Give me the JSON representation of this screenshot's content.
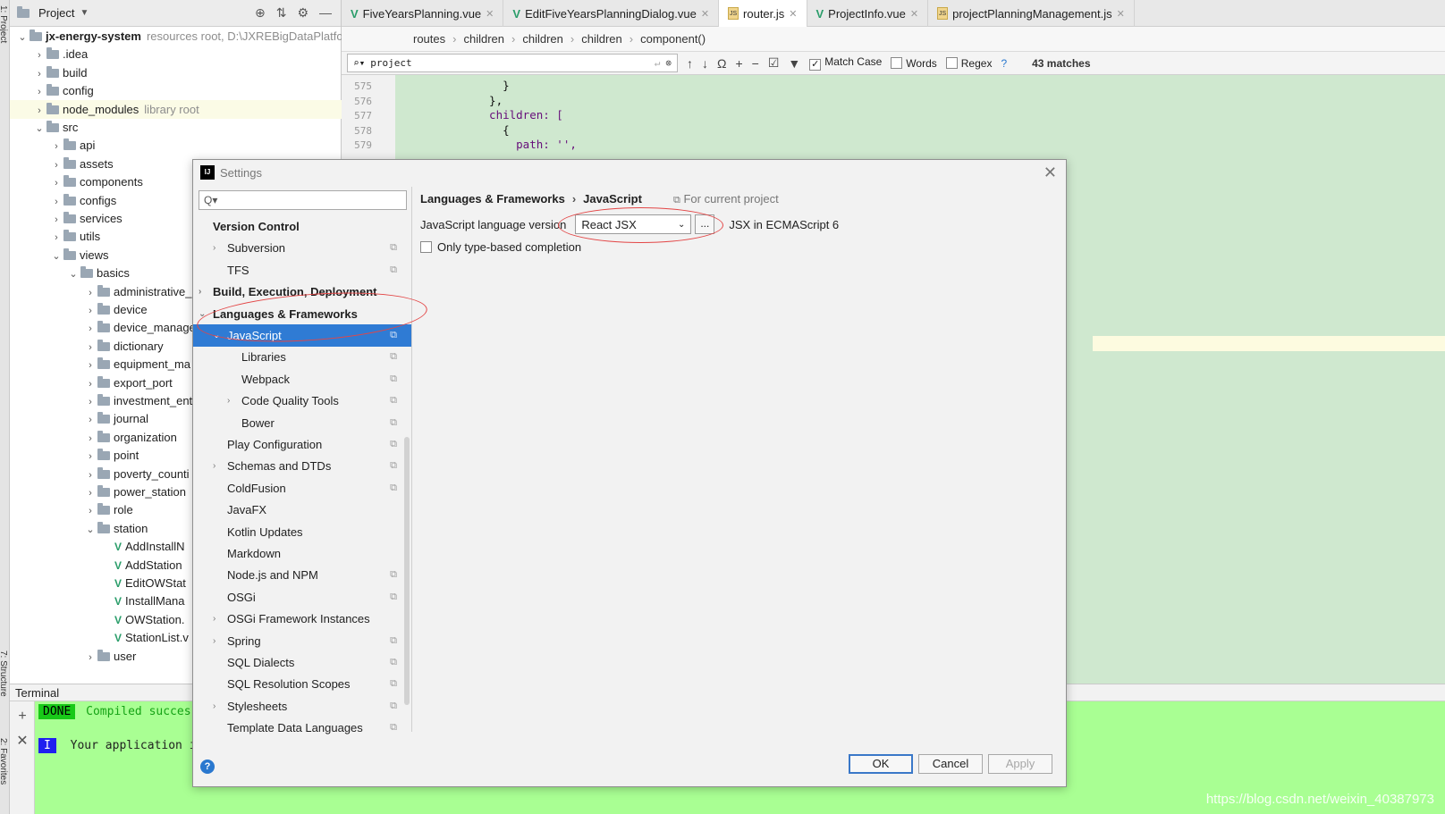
{
  "sidebar": {
    "strip_labels": [
      "1: Project",
      "7: Structure",
      "2: Favorites"
    ]
  },
  "project": {
    "header": "Project",
    "tree": [
      {
        "label": "jx-energy-system",
        "suffix": "resources root,  D:\\JXREBigDataPlatfo",
        "depth": 0,
        "arrow": "open",
        "bold": true
      },
      {
        "label": ".idea",
        "depth": 1,
        "arrow": "closed"
      },
      {
        "label": "build",
        "depth": 1,
        "arrow": "closed"
      },
      {
        "label": "config",
        "depth": 1,
        "arrow": "closed"
      },
      {
        "label": "node_modules",
        "suffix": "library root",
        "depth": 1,
        "arrow": "closed",
        "highlight": true
      },
      {
        "label": "src",
        "depth": 1,
        "arrow": "open"
      },
      {
        "label": "api",
        "depth": 2,
        "arrow": "closed"
      },
      {
        "label": "assets",
        "depth": 2,
        "arrow": "closed"
      },
      {
        "label": "components",
        "depth": 2,
        "arrow": "closed"
      },
      {
        "label": "configs",
        "depth": 2,
        "arrow": "closed"
      },
      {
        "label": "services",
        "depth": 2,
        "arrow": "closed"
      },
      {
        "label": "utils",
        "depth": 2,
        "arrow": "closed"
      },
      {
        "label": "views",
        "depth": 2,
        "arrow": "open"
      },
      {
        "label": "basics",
        "depth": 3,
        "arrow": "open"
      },
      {
        "label": "administrative_",
        "depth": 4,
        "arrow": "closed"
      },
      {
        "label": "device",
        "depth": 4,
        "arrow": "closed"
      },
      {
        "label": "device_manage",
        "depth": 4,
        "arrow": "closed"
      },
      {
        "label": "dictionary",
        "depth": 4,
        "arrow": "closed"
      },
      {
        "label": "equipment_ma",
        "depth": 4,
        "arrow": "closed"
      },
      {
        "label": "export_port",
        "depth": 4,
        "arrow": "closed"
      },
      {
        "label": "investment_ent",
        "depth": 4,
        "arrow": "closed"
      },
      {
        "label": "journal",
        "depth": 4,
        "arrow": "closed"
      },
      {
        "label": "organization",
        "depth": 4,
        "arrow": "closed"
      },
      {
        "label": "point",
        "depth": 4,
        "arrow": "closed"
      },
      {
        "label": "poverty_counti",
        "depth": 4,
        "arrow": "closed"
      },
      {
        "label": "power_station",
        "depth": 4,
        "arrow": "closed"
      },
      {
        "label": "role",
        "depth": 4,
        "arrow": "closed"
      },
      {
        "label": "station",
        "depth": 4,
        "arrow": "open"
      },
      {
        "label": "AddInstallN",
        "depth": 5,
        "type": "vue"
      },
      {
        "label": "AddStation",
        "depth": 5,
        "type": "vue"
      },
      {
        "label": "EditOWStat",
        "depth": 5,
        "type": "vue"
      },
      {
        "label": "InstallMana",
        "depth": 5,
        "type": "vue"
      },
      {
        "label": "OWStation.",
        "depth": 5,
        "type": "vue"
      },
      {
        "label": "StationList.v",
        "depth": 5,
        "type": "vue"
      },
      {
        "label": "user",
        "depth": 4,
        "arrow": "closed"
      }
    ]
  },
  "tabs": [
    {
      "label": "FiveYearsPlanning.vue",
      "type": "vue"
    },
    {
      "label": "EditFiveYearsPlanningDialog.vue",
      "type": "vue"
    },
    {
      "label": "router.js",
      "type": "js",
      "active": true
    },
    {
      "label": "ProjectInfo.vue",
      "type": "vue"
    },
    {
      "label": "projectPlanningManagement.js",
      "type": "js"
    }
  ],
  "breadcrumbs": [
    "routes",
    "children",
    "children",
    "children",
    "component()"
  ],
  "find": {
    "query": "project",
    "match_case": "Match Case",
    "words": "Words",
    "regex": "Regex",
    "help": "?",
    "matches": "43 matches"
  },
  "editor_lines": [
    {
      "num": "575",
      "code": "    }"
    },
    {
      "num": "576",
      "code": "  },"
    },
    {
      "num": "577",
      "code": "  children: ["
    },
    {
      "num": "578",
      "code": "    {"
    },
    {
      "num": "579",
      "code": "      path: '',"
    }
  ],
  "terminal": {
    "title": "Terminal",
    "done": "DONE",
    "line1": "Compiled succes",
    "badge": "I",
    "line2": "Your application i",
    "watermark": "https://blog.csdn.net/weixin_40387973"
  },
  "dialog": {
    "title": "Settings",
    "search_placeholder": "Q▾",
    "nav": [
      {
        "label": "Version Control",
        "depth": 0,
        "bold": true
      },
      {
        "label": "Subversion",
        "depth": 1,
        "arrow": true,
        "copy": true
      },
      {
        "label": "TFS",
        "depth": 1,
        "copy": true
      },
      {
        "label": "Build, Execution, Deployment",
        "depth": 0,
        "bold": true,
        "arrow": true
      },
      {
        "label": "Languages & Frameworks",
        "depth": 0,
        "bold": true,
        "arrow": "open"
      },
      {
        "label": "JavaScript",
        "depth": 1,
        "arrow": "open",
        "copy": true,
        "selected": true
      },
      {
        "label": "Libraries",
        "depth": 2,
        "copy": true
      },
      {
        "label": "Webpack",
        "depth": 2,
        "copy": true
      },
      {
        "label": "Code Quality Tools",
        "depth": 2,
        "arrow": true,
        "copy": true
      },
      {
        "label": "Bower",
        "depth": 2,
        "copy": true
      },
      {
        "label": "Play Configuration",
        "depth": 1,
        "copy": true
      },
      {
        "label": "Schemas and DTDs",
        "depth": 1,
        "arrow": true,
        "copy": true
      },
      {
        "label": "ColdFusion",
        "depth": 1,
        "copy": true
      },
      {
        "label": "JavaFX",
        "depth": 1
      },
      {
        "label": "Kotlin Updates",
        "depth": 1
      },
      {
        "label": "Markdown",
        "depth": 1
      },
      {
        "label": "Node.js and NPM",
        "depth": 1,
        "copy": true
      },
      {
        "label": "OSGi",
        "depth": 1,
        "copy": true
      },
      {
        "label": "OSGi Framework Instances",
        "depth": 1,
        "arrow": true
      },
      {
        "label": "Spring",
        "depth": 1,
        "arrow": true,
        "copy": true
      },
      {
        "label": "SQL Dialects",
        "depth": 1,
        "copy": true
      },
      {
        "label": "SQL Resolution Scopes",
        "depth": 1,
        "copy": true
      },
      {
        "label": "Stylesheets",
        "depth": 1,
        "arrow": true,
        "copy": true
      },
      {
        "label": "Template Data Languages",
        "depth": 1,
        "copy": true
      }
    ],
    "right": {
      "crumb1": "Languages & Frameworks",
      "crumb2": "JavaScript",
      "for_project": "For current project",
      "version_label": "JavaScript language version",
      "version_value": "React JSX",
      "dots": "...",
      "version_desc": "JSX in ECMAScript 6",
      "type_based": "Only type-based completion"
    },
    "buttons": {
      "ok": "OK",
      "cancel": "Cancel",
      "apply": "Apply",
      "help": "?"
    }
  }
}
